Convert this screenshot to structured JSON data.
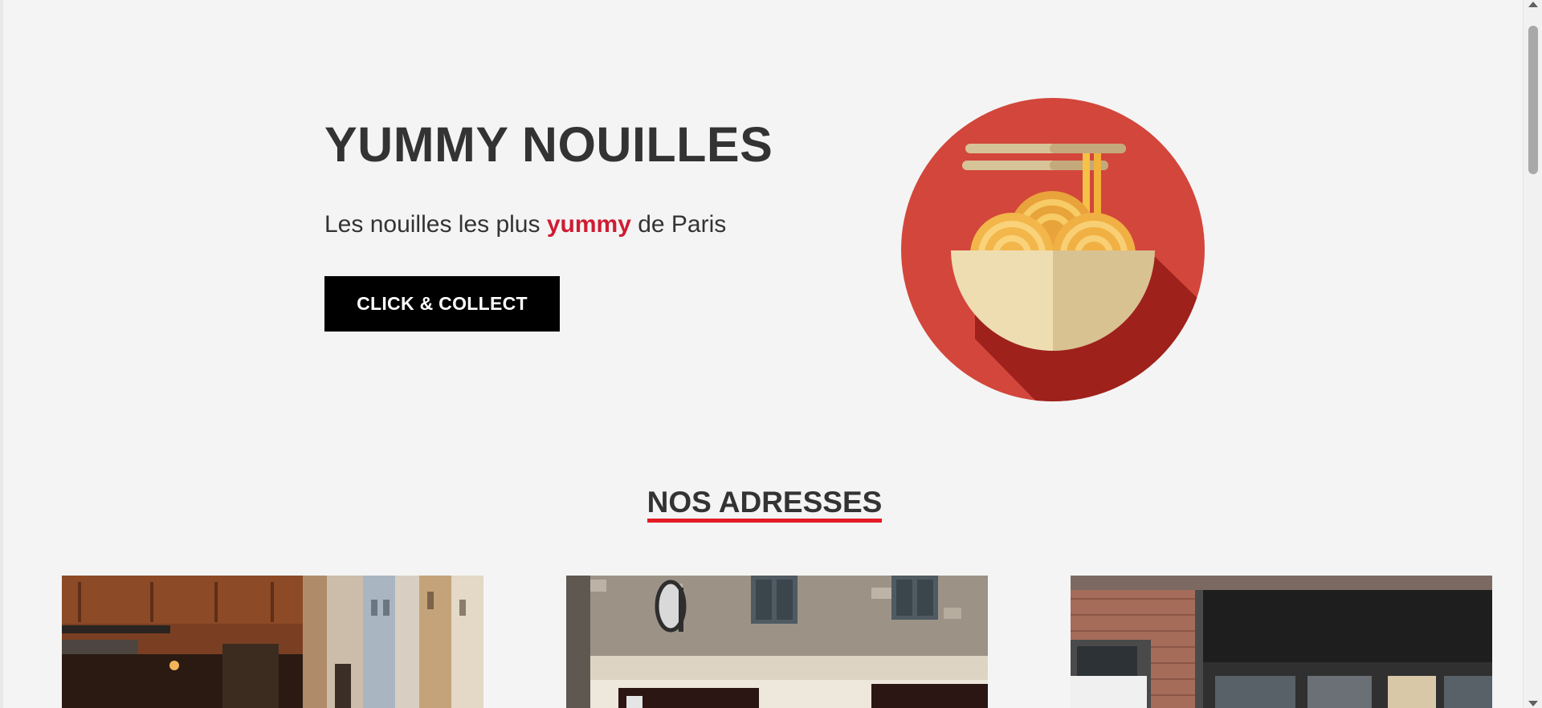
{
  "hero": {
    "title": "YUMMY NOUILLES",
    "tagline_before": "Les nouilles les plus ",
    "tagline_accent": "yummy",
    "tagline_after": " de Paris",
    "cta_label": "CLICK & COLLECT",
    "illustration_icon": "noodle-bowl-icon"
  },
  "addresses": {
    "title": "NOS ADRESSES",
    "cards": [
      {
        "photo": "restaurant-street-photo"
      },
      {
        "photo": "restaurant-facade-photo"
      },
      {
        "photo": "restaurant-brick-storefront-photo"
      }
    ]
  },
  "colors": {
    "background": "#f4f4f4",
    "text": "#333333",
    "accent": "#d01c33",
    "underline": "#e31b23",
    "button_bg": "#000000",
    "button_text": "#ffffff",
    "circle_red": "#d3463b"
  }
}
